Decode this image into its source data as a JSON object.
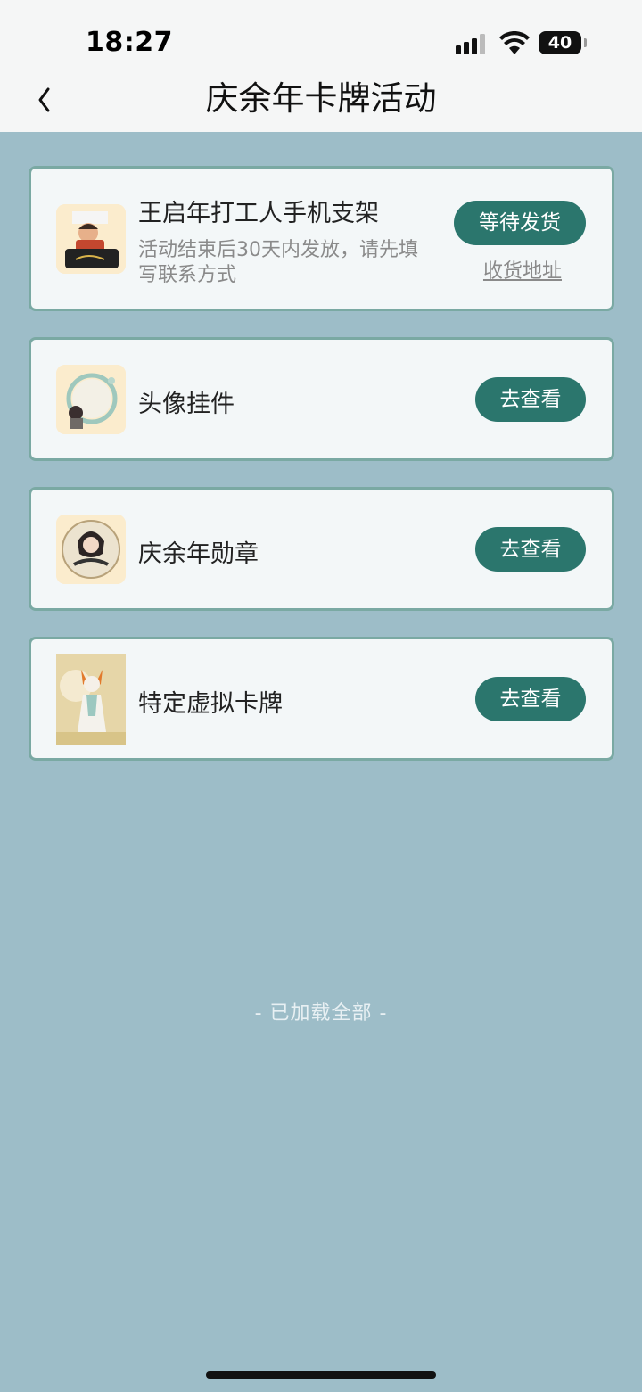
{
  "status_bar": {
    "time": "18:27",
    "battery": "40",
    "battery_level": 0.4
  },
  "nav": {
    "title": "庆余年卡牌活动",
    "back_icon": "chevron-left-icon"
  },
  "items": [
    {
      "title": "王启年打工人手机支架",
      "desc": "活动结束后30天内发放，请先填写联系方式",
      "button": "等待发货",
      "link": "收货地址",
      "thumb": "phone-stand-product-image"
    },
    {
      "title": "头像挂件",
      "button": "去查看",
      "thumb": "avatar-frame-image"
    },
    {
      "title": "庆余年勋章",
      "button": "去查看",
      "thumb": "medal-character-image"
    },
    {
      "title": "特定虚拟卡牌",
      "button": "去查看",
      "thumb": "fox-character-card-image"
    }
  ],
  "footer": {
    "text": "- 已加载全部 -"
  },
  "colors": {
    "background": "#9dbdc8",
    "accent": "#2b766d",
    "card": "#f3f7f8",
    "card_border": "#7aa9a3"
  }
}
